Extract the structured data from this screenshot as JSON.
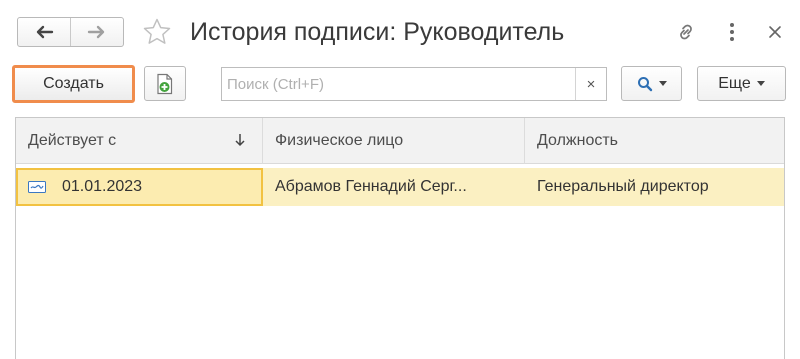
{
  "header": {
    "title": "История подписи: Руководитель",
    "icons": {
      "back": "arrow-left-icon",
      "forward": "arrow-right-icon",
      "favorite": "star-icon",
      "link": "link-icon",
      "more": "vertical-dots-icon",
      "close": "close-icon"
    },
    "close_glyph": "×"
  },
  "toolbar": {
    "create_label": "Создать",
    "copy_icon": "add-document-icon",
    "search_placeholder": "Поиск (Ctrl+F)",
    "search_value": "",
    "clear_glyph": "×",
    "search_icon": "magnifier-icon",
    "more_label": "Еще"
  },
  "table": {
    "columns": [
      {
        "label": "Действует с",
        "sort_icon": "sort-down-arrow-icon"
      },
      {
        "label": "Физическое лицо"
      },
      {
        "label": "Должность"
      }
    ],
    "rows": [
      {
        "icon": "record-icon",
        "date": "01.01.2023",
        "person": "Абрамов Геннадий Серг...",
        "position": "Генеральный директор",
        "selected": true
      }
    ]
  },
  "colors": {
    "accent_orange": "#f08c4c",
    "selected_row": "#fbf0c2",
    "selected_cell_border": "#f2c241",
    "search_icon_blue": "#2d6fb4"
  }
}
